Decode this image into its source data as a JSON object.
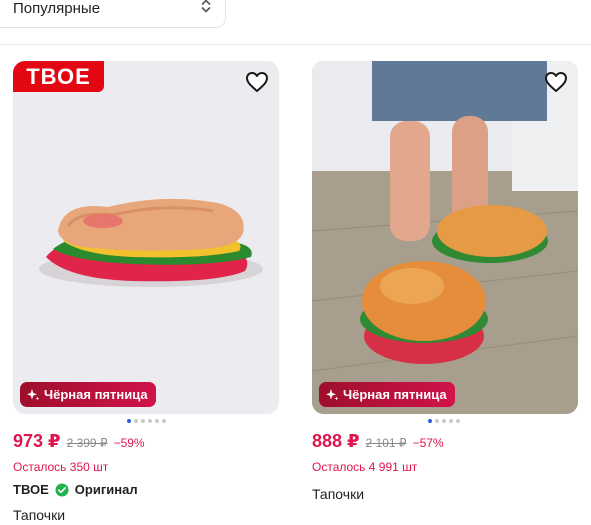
{
  "sort": {
    "label": "Популярные",
    "icon": "sort-chevrons-icon"
  },
  "products": [
    {
      "brand_tile": "ТВОЕ",
      "badge": "Чёрная пятница",
      "price": "973 ₽",
      "old_price": "2 399 ₽",
      "discount": "−59%",
      "stock": "Осталось 350 шт",
      "brand": "ТВОЕ",
      "original_label": "Оригинал",
      "title": "Тапочки",
      "image": "burger-slippers-product-photo"
    },
    {
      "badge": "Чёрная пятница",
      "price": "888 ₽",
      "old_price": "2 101 ₽",
      "discount": "−57%",
      "stock": "Осталось 4 991 шт",
      "title": "Тапочки",
      "image": "burger-slippers-worn-photo"
    }
  ],
  "colors": {
    "accent": "#e0174e",
    "badge_dark": "#9e0f2c",
    "brand_red": "#e30613",
    "verified": "#22b14c"
  }
}
